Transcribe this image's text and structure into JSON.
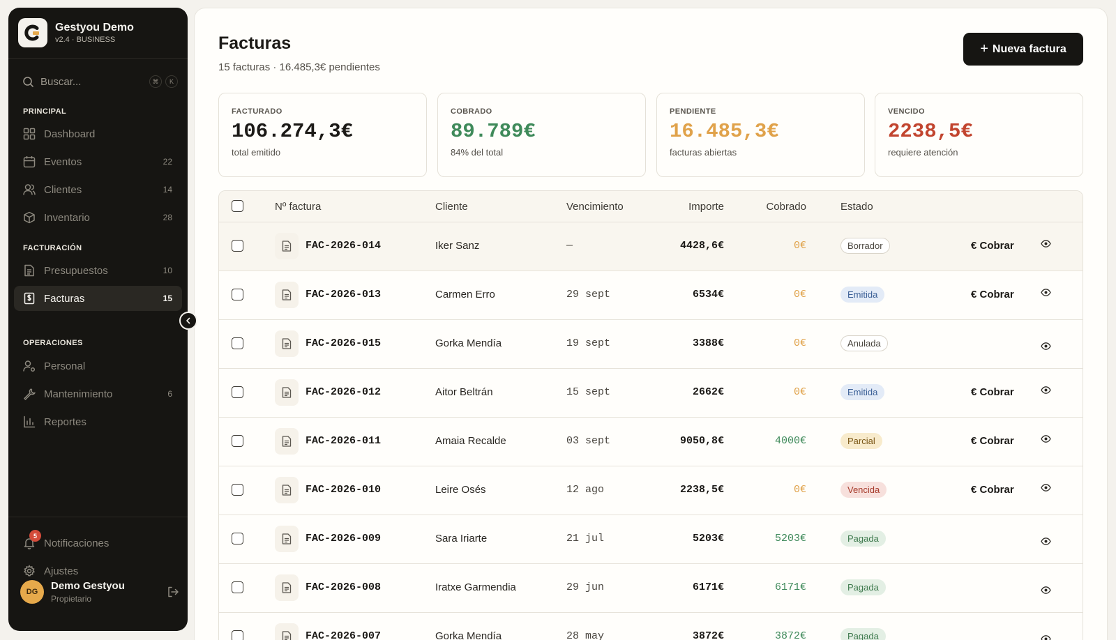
{
  "brand": {
    "name": "Gestyou Demo",
    "version": "v2.4 · BUSINESS"
  },
  "search": {
    "placeholder": "Buscar...",
    "kbd1": "⌘",
    "kbd2": "K"
  },
  "sidebar": {
    "section_principal": "PRINCIPAL",
    "section_facturacion": "FACTURACIÓN",
    "section_operaciones": "OPERACIONES",
    "items": [
      {
        "label": "Dashboard",
        "count": "",
        "icon": "grid-icon"
      },
      {
        "label": "Eventos",
        "count": "22",
        "icon": "calendar-icon"
      },
      {
        "label": "Clientes",
        "count": "14",
        "icon": "users-icon"
      },
      {
        "label": "Inventario",
        "count": "28",
        "icon": "box-icon"
      },
      {
        "label": "Presupuestos",
        "count": "10",
        "icon": "file-icon"
      },
      {
        "label": "Facturas",
        "count": "15",
        "icon": "invoice-icon"
      },
      {
        "label": "Personal",
        "count": "",
        "icon": "user-settings-icon"
      },
      {
        "label": "Mantenimiento",
        "count": "6",
        "icon": "wrench-icon"
      },
      {
        "label": "Reportes",
        "count": "",
        "icon": "bar-chart-icon"
      }
    ],
    "notifications": {
      "label": "Notificaciones",
      "badge": "5"
    },
    "settings": "Ajustes",
    "user": {
      "initials": "DG",
      "name": "Demo Gestyou",
      "role": "Propietario"
    }
  },
  "page": {
    "title": "Facturas",
    "subtitle": "15 facturas · 16.485,3€ pendientes",
    "new_button": "Nueva factura"
  },
  "stats": [
    {
      "label": "FACTURADO",
      "value": "106.274,3€",
      "sub": "total emitido",
      "color": "#1c1a17"
    },
    {
      "label": "COBRADO",
      "value": "89.789€",
      "sub": "84% del total",
      "color": "#3f8a5a"
    },
    {
      "label": "PENDIENTE",
      "value": "16.485,3€",
      "sub": "facturas abiertas",
      "color": "#e0a24a"
    },
    {
      "label": "VENCIDO",
      "value": "2238,5€",
      "sub": "requiere atención",
      "color": "#c2452f"
    }
  ],
  "table": {
    "headers": {
      "number": "Nº factura",
      "client": "Cliente",
      "due": "Vencimiento",
      "amount": "Importe",
      "paid": "Cobrado",
      "status": "Estado"
    },
    "cobrar_label": "Cobrar",
    "rows": [
      {
        "number": "FAC-2026-014",
        "client": "Iker Sanz",
        "due": "—",
        "amount": "4428,6€",
        "paid": "0€",
        "status": "Borrador",
        "cobrar": true
      },
      {
        "number": "FAC-2026-013",
        "client": "Carmen Erro",
        "due": "29 sept",
        "amount": "6534€",
        "paid": "0€",
        "status": "Emitida",
        "cobrar": true
      },
      {
        "number": "FAC-2026-015",
        "client": "Gorka Mendía",
        "due": "19 sept",
        "amount": "3388€",
        "paid": "0€",
        "status": "Anulada",
        "cobrar": false
      },
      {
        "number": "FAC-2026-012",
        "client": "Aitor Beltrán",
        "due": "15 sept",
        "amount": "2662€",
        "paid": "0€",
        "status": "Emitida",
        "cobrar": true
      },
      {
        "number": "FAC-2026-011",
        "client": "Amaia Recalde",
        "due": "03 sept",
        "amount": "9050,8€",
        "paid": "4000€",
        "status": "Parcial",
        "cobrar": true
      },
      {
        "number": "FAC-2026-010",
        "client": "Leire Osés",
        "due": "12 ago",
        "amount": "2238,5€",
        "paid": "0€",
        "status": "Vencida",
        "cobrar": true
      },
      {
        "number": "FAC-2026-009",
        "client": "Sara Iriarte",
        "due": "21 jul",
        "amount": "5203€",
        "paid": "5203€",
        "status": "Pagada",
        "cobrar": false
      },
      {
        "number": "FAC-2026-008",
        "client": "Iratxe Garmendia",
        "due": "29 jun",
        "amount": "6171€",
        "paid": "6171€",
        "status": "Pagada",
        "cobrar": false
      },
      {
        "number": "FAC-2026-007",
        "client": "Gorka Mendía",
        "due": "28 may",
        "amount": "3872€",
        "paid": "3872€",
        "status": "Pagada",
        "cobrar": false
      }
    ]
  },
  "status_styles": {
    "Borrador": {
      "bg": "#ffffff",
      "fg": "#4a463f",
      "border": "#d9d4ca"
    },
    "Emitida": {
      "bg": "#e3ebf7",
      "fg": "#3a5f96",
      "border": "#e3ebf7"
    },
    "Anulada": {
      "bg": "#ffffff",
      "fg": "#4a463f",
      "border": "#d9d4ca"
    },
    "Parcial": {
      "bg": "#f8ebcc",
      "fg": "#7a5716",
      "border": "#f8ebcc"
    },
    "Vencida": {
      "bg": "#f7e0dc",
      "fg": "#a63a2a",
      "border": "#f7e0dc"
    },
    "Pagada": {
      "bg": "#e3efe4",
      "fg": "#3f7a4e",
      "border": "#e3efe4"
    }
  },
  "colors": {
    "paid_zero": "#e0a24a",
    "paid_positive": "#3f8a5a"
  }
}
